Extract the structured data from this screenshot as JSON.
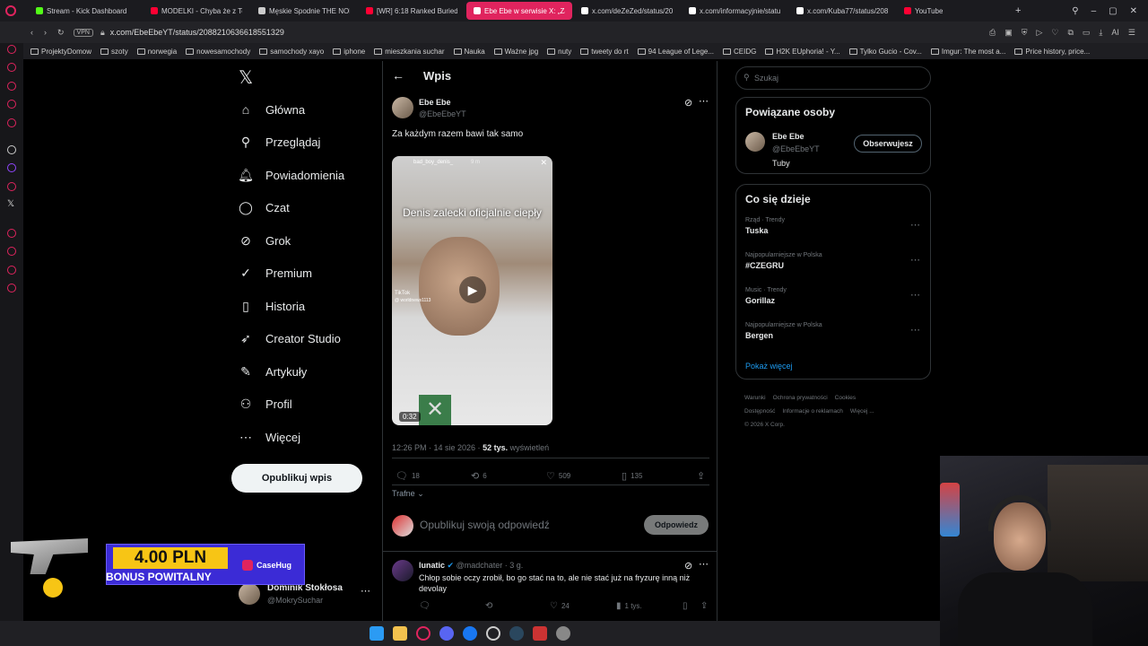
{
  "browser": {
    "tabs": [
      {
        "label": "Stream - Kick Dashboard",
        "color": "#53fc18",
        "active": false
      },
      {
        "label": "MODELKI - Chyba że z Te",
        "color": "#ff0033",
        "active": false
      },
      {
        "label": "Męskie Spodnie THE NOR",
        "color": "#cccccc",
        "active": false
      },
      {
        "label": "[WR] 6:18 Ranked Buried T",
        "color": "#ff0033",
        "active": false
      },
      {
        "label": "Ebe Ebe w serwisie X: „Za",
        "color": "#ffffff",
        "active": true
      },
      {
        "label": "x.com/deZeZed/status/20",
        "color": "#ffffff",
        "active": false
      },
      {
        "label": "x.com/informacyjnie/statu",
        "color": "#ffffff",
        "active": false
      },
      {
        "label": "x.com/Kuba77/status/208",
        "color": "#ffffff",
        "active": false
      },
      {
        "label": "YouTube",
        "color": "#ff0033",
        "active": false
      }
    ],
    "vpn_label": "VPN",
    "url": "x.com/EbeEbeYT/status/2088210636618551329",
    "ai_label": "AI",
    "bookmarks": [
      "ProjektyDomow",
      "szoty",
      "norwegia",
      "nowesamochody",
      "samochody xayo",
      "iphone",
      "mieszkania suchar",
      "Nauka",
      "Ważne jpg",
      "nuty",
      "tweety do rt",
      "94 League of Lege...",
      "CEIDG",
      "H2K EUphoria! - Y...",
      "Tylko Gucio - Cov...",
      "Imgur: The most a...",
      "Price history, price..."
    ]
  },
  "x_nav": {
    "logo": "𝕏",
    "items": [
      {
        "label": "Główna",
        "icon": "home-icon",
        "glyph": "⌂"
      },
      {
        "label": "Przeglądaj",
        "icon": "search-icon",
        "glyph": "⚲"
      },
      {
        "label": "Powiadomienia",
        "icon": "bell-icon",
        "glyph": "🔔︎"
      },
      {
        "label": "Czat",
        "icon": "chat-icon",
        "glyph": "◯"
      },
      {
        "label": "Grok",
        "icon": "grok-icon",
        "glyph": "⊘"
      },
      {
        "label": "Premium",
        "icon": "premium-icon",
        "glyph": "✓"
      },
      {
        "label": "Historia",
        "icon": "bookmark-icon",
        "glyph": "▯"
      },
      {
        "label": "Creator Studio",
        "icon": "rocket-icon",
        "glyph": "➶"
      },
      {
        "label": "Artykuły",
        "icon": "article-icon",
        "glyph": "✎"
      },
      {
        "label": "Profil",
        "icon": "profile-icon",
        "glyph": "⚇"
      },
      {
        "label": "Więcej",
        "icon": "more-icon",
        "glyph": "⋯"
      }
    ],
    "post_button": "Opublikuj wpis",
    "account": {
      "name": "Dominik Stokłosa",
      "handle": "@MokrySuchar"
    }
  },
  "post": {
    "header_title": "Wpis",
    "author_name": "Ebe Ebe",
    "author_handle": "@EbeEbeYT",
    "text": "Za każdym razem bawi tak samo",
    "video": {
      "overlay_user": "bad_boy_denis_",
      "overlay_age": "9 m",
      "caption": "Denis zalecki oficjalnie ciepły",
      "duration": "0:32",
      "tiktok_label": "TikTok",
      "tiktok_handle": "@ worldnews1113"
    },
    "time": "12:26 PM · 14 sie 2026 ·",
    "views_count": "52 tys.",
    "views_label": "wyświetleń",
    "replies": "18",
    "reposts": "6",
    "likes": "509",
    "bookmarks": "135",
    "sort_label": "Trafne",
    "reply_placeholder": "Opublikuj swoją odpowiedź",
    "reply_button": "Odpowiedz"
  },
  "reply": {
    "author_name": "lunatic",
    "author_handle": "@madchater",
    "age": "· 3 g.",
    "text": "Chłop sobie oczy zrobił, bo go stać na to, ale nie stać już na fryzurę inną niż devolay",
    "likes": "24",
    "views": "1 tys."
  },
  "sidebar": {
    "search_placeholder": "Szukaj",
    "related_title": "Powiązane osoby",
    "related_person": {
      "name": "Ebe Ebe",
      "handle": "@EbeEbeYT",
      "bio": "Tuby",
      "follow_label": "Obserwujesz"
    },
    "trending_title": "Co się dzieje",
    "trends": [
      {
        "context": "Rząd · Trendy",
        "name": "Tuska"
      },
      {
        "context": "Najpopularniejsze w Polska",
        "name": "#CZEGRU"
      },
      {
        "context": "Music · Trendy",
        "name": "Gorillaz"
      },
      {
        "context": "Najpopularniejsze w Polska",
        "name": "Bergen"
      }
    ],
    "show_more": "Pokaż więcej",
    "footer_links": [
      "Warunki",
      "Ochrona prywatności",
      "Cookies",
      "Dostępność",
      "Informacje o reklamach",
      "Więcej ...",
      "© 2026 X Corp."
    ]
  },
  "promo": {
    "amount": "4.00 PLN",
    "subtitle": "BONUS POWITALNY",
    "brand": "CaseHug"
  },
  "colors": {
    "accent_blue": "#1d9bf0",
    "opera_red": "#e0245e",
    "promo_bg": "#3b2bd6",
    "promo_amount": "#f7c515"
  }
}
